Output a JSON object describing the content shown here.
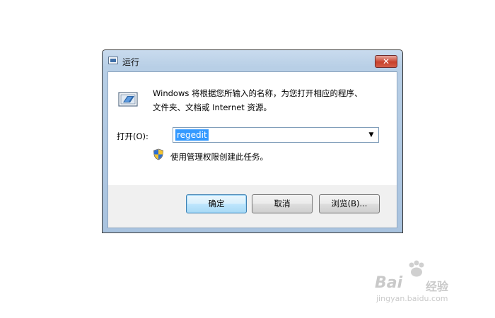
{
  "window": {
    "title": "运行",
    "close_label": "✕"
  },
  "description": {
    "line1": "Windows 将根据您所输入的名称，为您打开相应的程序、",
    "line2": "文件夹、文档或 Internet 资源。"
  },
  "open_field": {
    "label": "打开(O):",
    "value": "regedit"
  },
  "admin_note": "使用管理权限创建此任务。",
  "buttons": {
    "ok": "确定",
    "cancel": "取消",
    "browse": "浏览(B)..."
  },
  "watermark": {
    "brand": "Bai",
    "brand_suffix": "经验",
    "url": "jingyan.baidu.com"
  },
  "icons": {
    "title": "run-icon",
    "large": "run-icon",
    "shield": "uac-shield-icon",
    "dropdown": "chevron-down-icon",
    "close": "close-icon"
  }
}
